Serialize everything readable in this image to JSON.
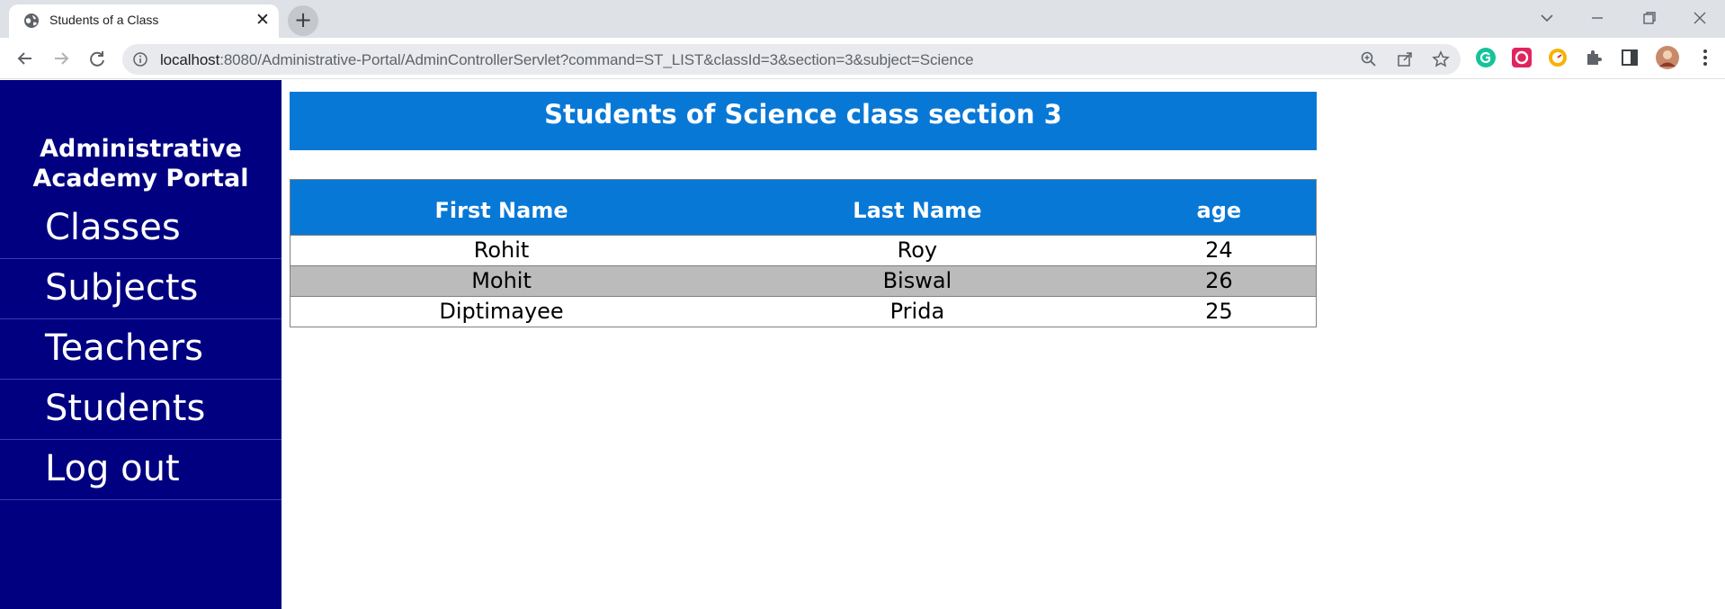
{
  "browser": {
    "tab_title": "Students of a Class",
    "url_host": "localhost",
    "url_rest": ":8080/Administrative-Portal/AdminControllerServlet?command=ST_LIST&classId=3&section=3&subject=Science"
  },
  "sidebar": {
    "brand_line1": "Administrative",
    "brand_line2": "Academy Portal",
    "items": [
      {
        "label": "Classes"
      },
      {
        "label": "Subjects"
      },
      {
        "label": "Teachers"
      },
      {
        "label": "Students"
      },
      {
        "label": "Log out"
      }
    ]
  },
  "main": {
    "title": "Students of Science class section 3",
    "table": {
      "headers": [
        "First Name",
        "Last Name",
        "age"
      ],
      "rows": [
        [
          "Rohit",
          "Roy",
          "24"
        ],
        [
          "Mohit",
          "Biswal",
          "26"
        ],
        [
          "Diptimayee",
          "Prida",
          "25"
        ]
      ]
    }
  },
  "colors": {
    "sidebar_bg": "#000080",
    "header_bg": "#0878d6",
    "alt_row_bg": "#bbbbbb"
  }
}
